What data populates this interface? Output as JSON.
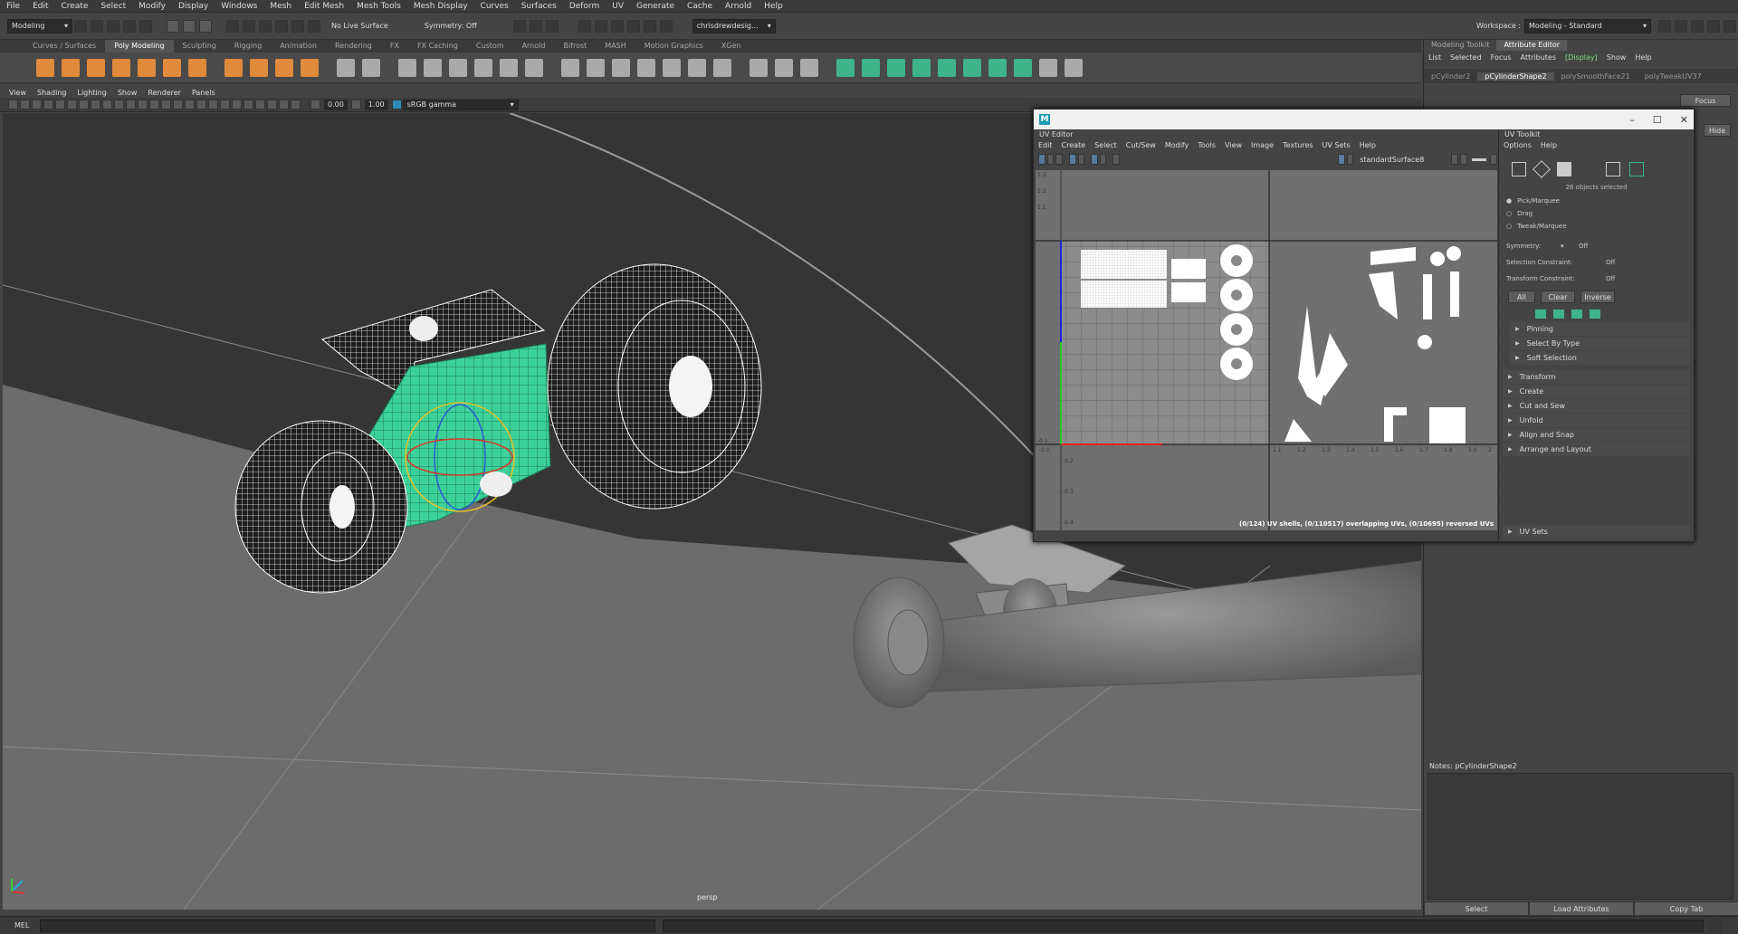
{
  "menubar": [
    "File",
    "Edit",
    "Create",
    "Select",
    "Modify",
    "Display",
    "Windows",
    "Mesh",
    "Edit Mesh",
    "Mesh Tools",
    "Mesh Display",
    "Curves",
    "Surfaces",
    "Deform",
    "UV",
    "Generate",
    "Cache",
    "Arnold",
    "Help"
  ],
  "status": {
    "mode": "Modeling",
    "live_surface": "No Live Surface",
    "symmetry": "Symmetry: Off",
    "user": "chrisdrewdesig...",
    "workspace_label": "Workspace :",
    "workspace": "Modeling - Standard"
  },
  "shelf_tabs": [
    "Curves / Surfaces",
    "Poly Modeling",
    "Sculpting",
    "Rigging",
    "Animation",
    "Rendering",
    "FX",
    "FX Caching",
    "Custom",
    "Arnold",
    "Bifrost",
    "MASH",
    "Motion Graphics",
    "XGen"
  ],
  "shelf_active": "Poly Modeling",
  "viewport": {
    "menu": [
      "View",
      "Shading",
      "Lighting",
      "Show",
      "Renderer",
      "Panels"
    ],
    "field1": "0.00",
    "field2": "1.00",
    "color_space": "sRGB gamma",
    "camera_label": "persp"
  },
  "attr": {
    "tabs": [
      "Modeling Toolkit",
      "Attribute Editor"
    ],
    "active_tab": "Attribute Editor",
    "menu": [
      "List",
      "Selected",
      "Focus",
      "Attributes",
      "[Display]",
      "Show",
      "Help"
    ],
    "nodes": [
      "pCylinder2",
      "pCylinderShape2",
      "polySmoothFace21",
      "polyTweakUV37"
    ],
    "active_node": "pCylinderShape2",
    "focus": "Focus",
    "hide": "Hide",
    "notes_label": "Notes:  pCylinderShape2",
    "bottom_buttons": [
      "Select",
      "Load Attributes",
      "Copy Tab"
    ]
  },
  "uv_editor": {
    "panel_label": "UV Editor",
    "menu": [
      "Edit",
      "Create",
      "Select",
      "Cut/Sew",
      "Modify",
      "Tools",
      "View",
      "Image",
      "Textures",
      "UV Sets",
      "Help"
    ],
    "material": "standardSurface8",
    "status": "(0/124) UV shells, (0/110517) overlapping UVs, (0/10695) reversed UVs",
    "axis_y": [
      "1.3",
      "1.2",
      "1.1",
      "-0.1",
      "-0.2",
      "-0.3",
      "-0.4"
    ],
    "axis_x": [
      "-0.1",
      "1.1",
      "1.2",
      "1.3",
      "1.4",
      "1.5",
      "1.6",
      "1.7",
      "1.8",
      "1.9",
      "2"
    ]
  },
  "uv_toolkit": {
    "label": "UV Toolkit",
    "menu": [
      "Options",
      "Help"
    ],
    "selected": "26 objects selected",
    "tools": [
      "Pick/Marquee",
      "Drag",
      "Tweak/Marquee"
    ],
    "symmetry_label": "Symmetry:",
    "symmetry_value": "Off",
    "selection_constraint_label": "Selection Constraint:",
    "selection_constraint_value": "Off",
    "transform_constraint_label": "Transform Constraint:",
    "transform_constraint_value": "Off",
    "buttons": [
      "All",
      "Clear",
      "Inverse"
    ],
    "subsections": [
      "Pinning",
      "Select By Type",
      "Soft Selection"
    ],
    "sections": [
      "Transform",
      "Create",
      "Cut and Sew",
      "Unfold",
      "Align and Snap",
      "Arrange and Layout"
    ],
    "uv_sets": "UV Sets"
  },
  "cmd": {
    "label": "MEL"
  }
}
